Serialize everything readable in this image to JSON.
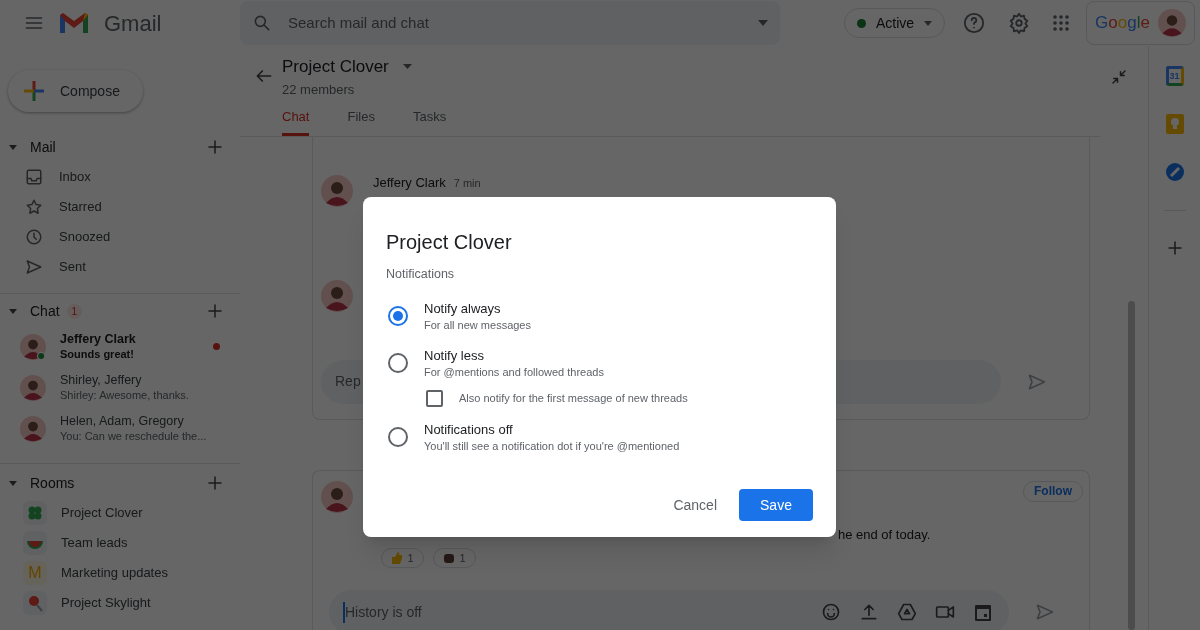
{
  "header": {
    "app_name": "Gmail",
    "search": {
      "placeholder": "Search mail and chat"
    },
    "status": {
      "label": "Active",
      "color": "#0a3316"
    },
    "account_brand": "Google"
  },
  "compose": "Compose",
  "mail": {
    "title": "Mail",
    "expanded": true,
    "items": [
      {
        "label": "Inbox"
      },
      {
        "label": "Starred"
      },
      {
        "label": "Snoozed"
      },
      {
        "label": "Sent"
      }
    ]
  },
  "chat": {
    "title": "Chat",
    "badge": "1",
    "expanded": true,
    "items": [
      {
        "name": "Jeffery Clark",
        "preview": "Sounds great!",
        "unread": true,
        "online": true
      },
      {
        "name": "Shirley, Jeffery",
        "preview": "Shirley: Awesome, thanks.",
        "unread": false,
        "online": false
      },
      {
        "name": "Helen, Adam, Gregory",
        "preview": "You: Can we reschedule the...",
        "unread": false,
        "online": false
      }
    ]
  },
  "rooms": {
    "title": "Rooms",
    "expanded": true,
    "items": [
      {
        "name": "Project Clover",
        "kind": "clover"
      },
      {
        "name": "Team leads",
        "kind": "melon"
      },
      {
        "name": "Marketing updates",
        "kind": "initial",
        "initial": "M"
      },
      {
        "name": "Project Skylight",
        "kind": "lollipop"
      }
    ]
  },
  "room": {
    "title": "Project Clover",
    "subtitle": "22 members",
    "tabs": [
      {
        "label": "Chat",
        "selected": true
      },
      {
        "label": "Files",
        "selected": false
      },
      {
        "label": "Tasks",
        "selected": false
      }
    ]
  },
  "threads": [
    {
      "messages": [
        {
          "author": "Jeffery Clark",
          "time": "7 min"
        }
      ],
      "reply_placeholder": "Rep"
    },
    {
      "follow": "Follow",
      "text": "he end of today.",
      "reactions": [
        {
          "kind": "thumb",
          "count": "1"
        },
        {
          "kind": "fist",
          "count": "1"
        }
      ],
      "composer_placeholder": "History is off"
    }
  ],
  "rail": {
    "calendar_day": "31"
  },
  "dialog": {
    "title": "Project Clover",
    "section": "Notifications",
    "options": [
      {
        "label": "Notify always",
        "description": "For all new messages",
        "selected": true
      },
      {
        "label": "Notify less",
        "description": "For @mentions and followed threads",
        "selected": false
      },
      {
        "label": "Notifications off",
        "description": "You'll still see a notification dot if you're @mentioned",
        "selected": false
      }
    ],
    "extra": {
      "label": "Also notify for the first message of new threads",
      "checked": false
    },
    "cancel": "Cancel",
    "save": "Save"
  }
}
